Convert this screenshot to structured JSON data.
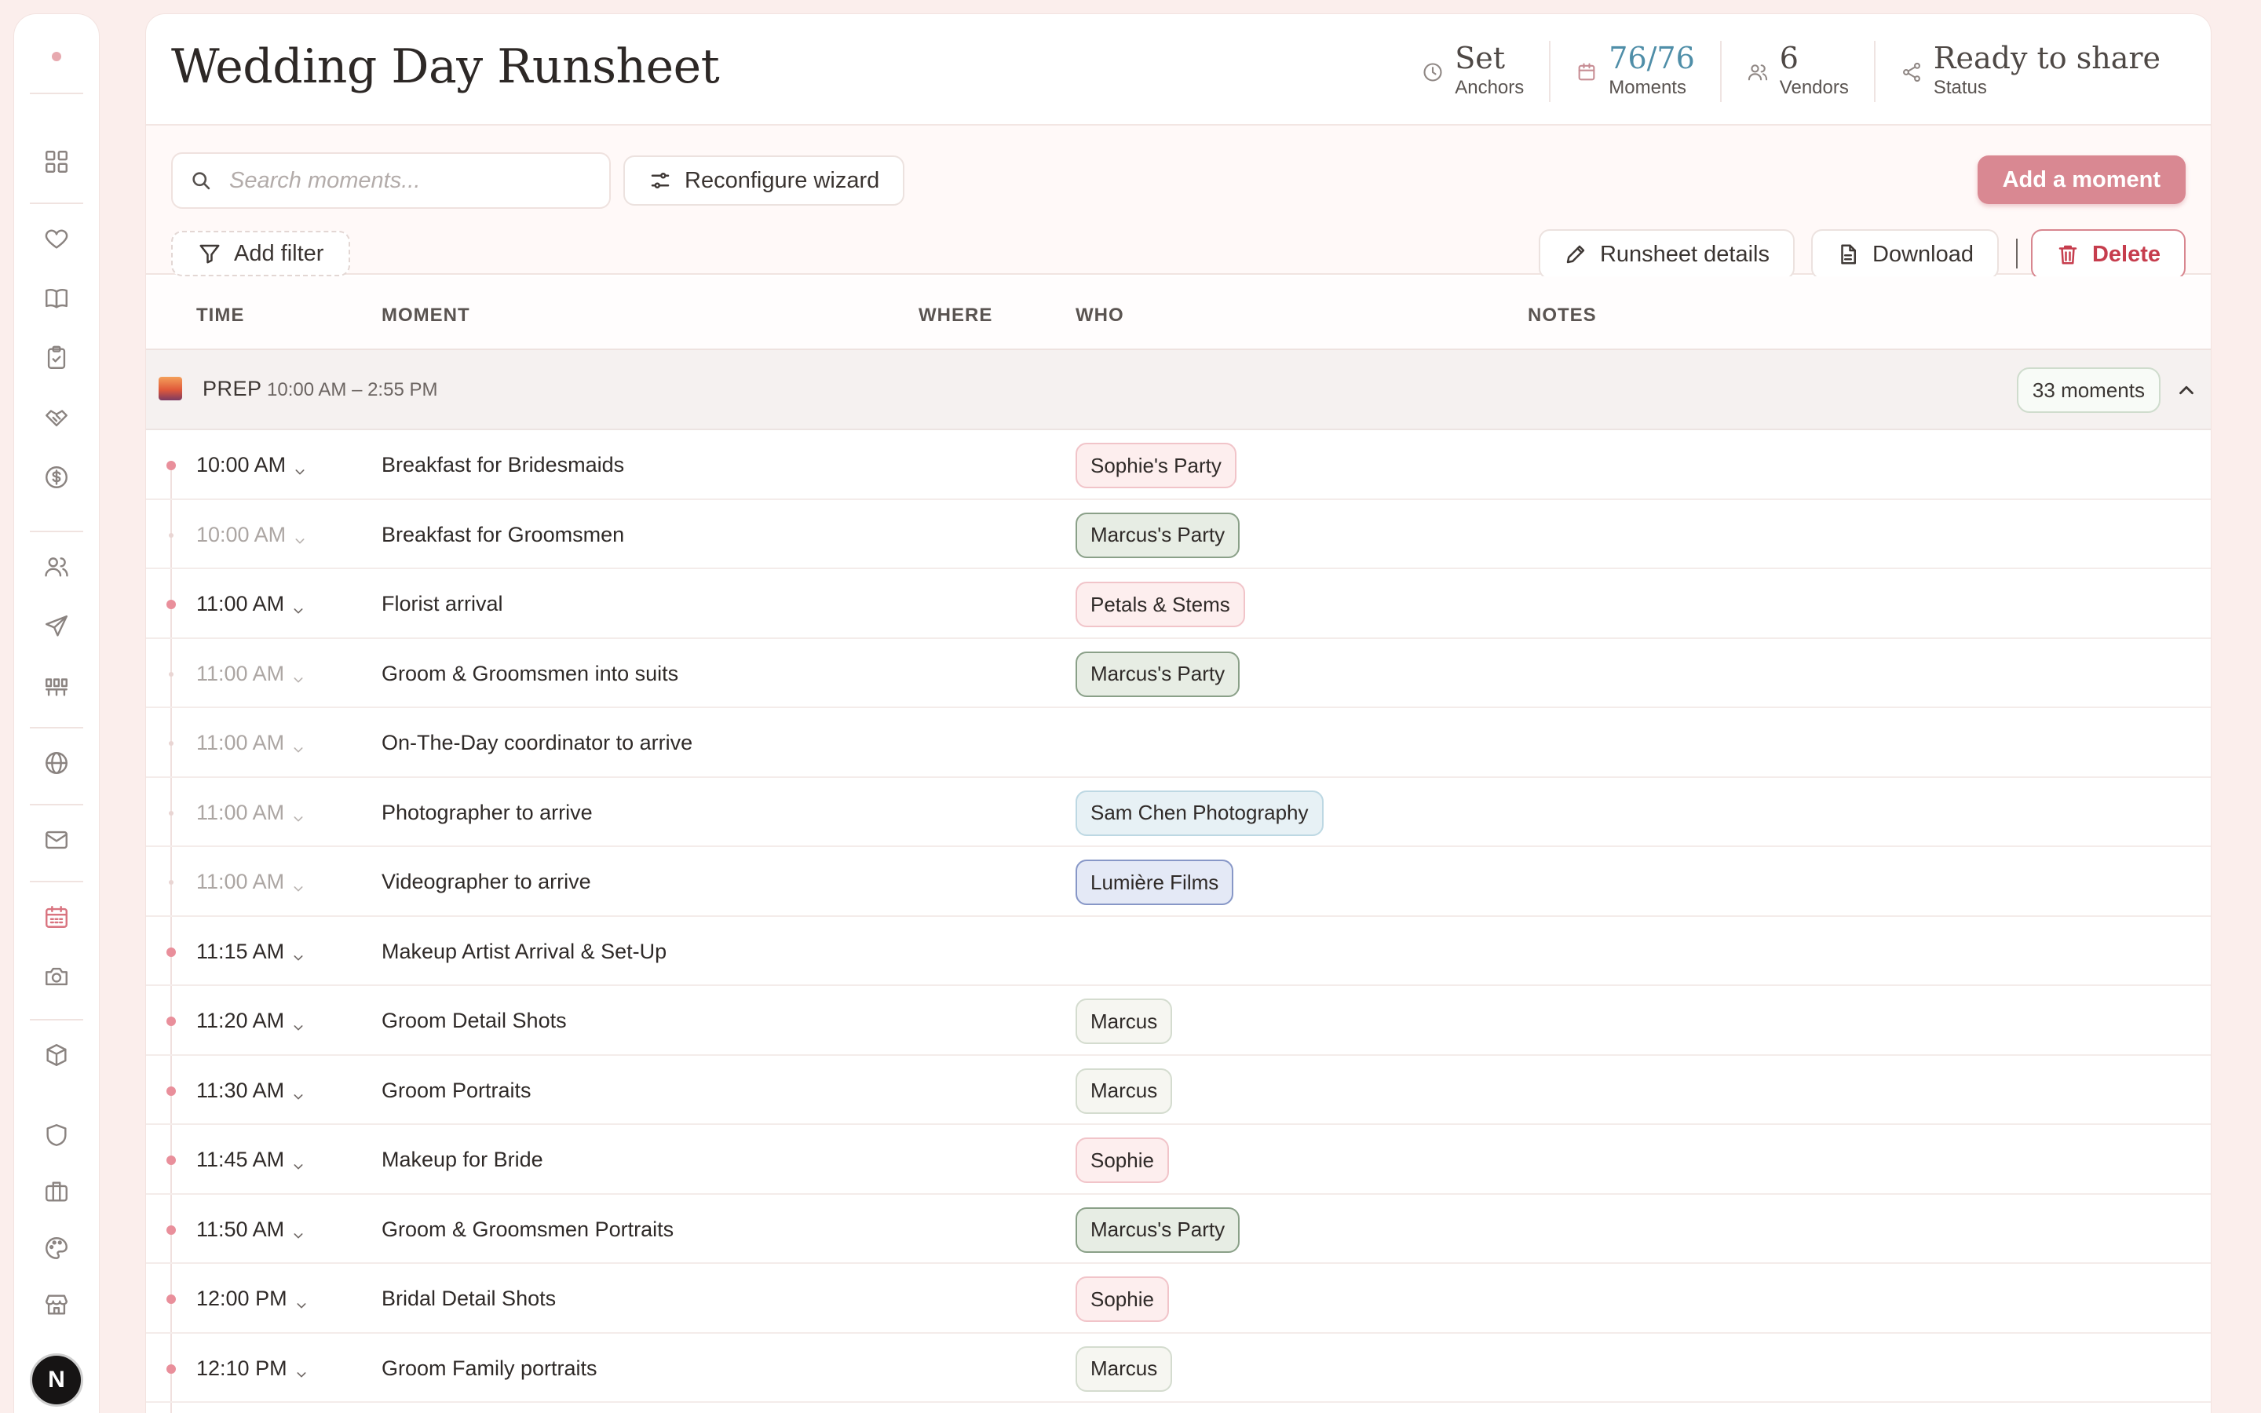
{
  "sidebar": {
    "icons": [
      "grid-icon",
      "heart-icon",
      "book-icon",
      "clipboard-icon",
      "handshake-icon",
      "dollar-icon",
      "users-icon",
      "send-icon",
      "seating-icon",
      "globe-icon",
      "mail-icon",
      "calendar-icon",
      "camera-icon",
      "package-icon",
      "shield-icon",
      "briefcase-icon",
      "palette-icon",
      "store-icon"
    ],
    "active": "calendar-icon",
    "avatar_letter": "N"
  },
  "header": {
    "title": "Wedding Day Runsheet",
    "stats": [
      {
        "value": "Set",
        "label": "Anchors",
        "icon": "clock-icon"
      },
      {
        "value": "76/76",
        "label": "Moments",
        "icon": "calendar-icon"
      },
      {
        "value": "6",
        "label": "Vendors",
        "icon": "users-icon"
      },
      {
        "value": "Ready to share",
        "label": "Status",
        "icon": "share-icon"
      }
    ]
  },
  "toolbar": {
    "search_placeholder": "Search moments...",
    "reconfigure_label": "Reconfigure wizard",
    "add_moment_label": "Add a moment",
    "add_filter_label": "Add filter",
    "details_label": "Runsheet details",
    "download_label": "Download",
    "delete_label": "Delete"
  },
  "columns": {
    "time": "TIME",
    "moment": "MOMENT",
    "where": "WHERE",
    "who": "WHO",
    "notes": "NOTES"
  },
  "group": {
    "name": "PREP",
    "range": "10:00 AM – 2:55 PM",
    "count": "33 moments"
  },
  "colors": {
    "accent": "#d98892",
    "danger": "#c63d4d",
    "link": "#4f8ea8"
  },
  "rows": [
    {
      "time": "10:00 AM",
      "moment": "Breakfast for Bridesmaids",
      "who": "Sophie's Party",
      "tone": "pink",
      "anchor": true
    },
    {
      "time": "10:00 AM",
      "moment": "Breakfast for Groomsmen",
      "who": "Marcus's Party",
      "tone": "green",
      "anchor": false
    },
    {
      "time": "11:00 AM",
      "moment": "Florist arrival",
      "who": "Petals & Stems",
      "tone": "pink",
      "anchor": true
    },
    {
      "time": "11:00 AM",
      "moment": "Groom & Groomsmen into suits",
      "who": "Marcus's Party",
      "tone": "green",
      "anchor": false
    },
    {
      "time": "11:00 AM",
      "moment": "On-The-Day coordinator to arrive",
      "who": "",
      "tone": "",
      "anchor": false
    },
    {
      "time": "11:00 AM",
      "moment": "Photographer to arrive",
      "who": "Sam Chen Photography",
      "tone": "blue",
      "anchor": false
    },
    {
      "time": "11:00 AM",
      "moment": "Videographer to arrive",
      "who": "Lumière Films",
      "tone": "lavender",
      "anchor": false
    },
    {
      "time": "11:15 AM",
      "moment": "Makeup Artist Arrival & Set-Up",
      "who": "",
      "tone": "",
      "anchor": true
    },
    {
      "time": "11:20 AM",
      "moment": "Groom Detail Shots",
      "who": "Marcus",
      "tone": "neutral",
      "anchor": true
    },
    {
      "time": "11:30 AM",
      "moment": "Groom Portraits",
      "who": "Marcus",
      "tone": "neutral",
      "anchor": true
    },
    {
      "time": "11:45 AM",
      "moment": "Makeup for Bride",
      "who": "Sophie",
      "tone": "pink",
      "anchor": true
    },
    {
      "time": "11:50 AM",
      "moment": "Groom & Groomsmen Portraits",
      "who": "Marcus's Party",
      "tone": "green",
      "anchor": true
    },
    {
      "time": "12:00 PM",
      "moment": "Bridal Detail Shots",
      "who": "Sophie",
      "tone": "pink",
      "anchor": true
    },
    {
      "time": "12:10 PM",
      "moment": "Groom Family portraits",
      "who": "Marcus",
      "tone": "neutral",
      "anchor": true
    }
  ]
}
